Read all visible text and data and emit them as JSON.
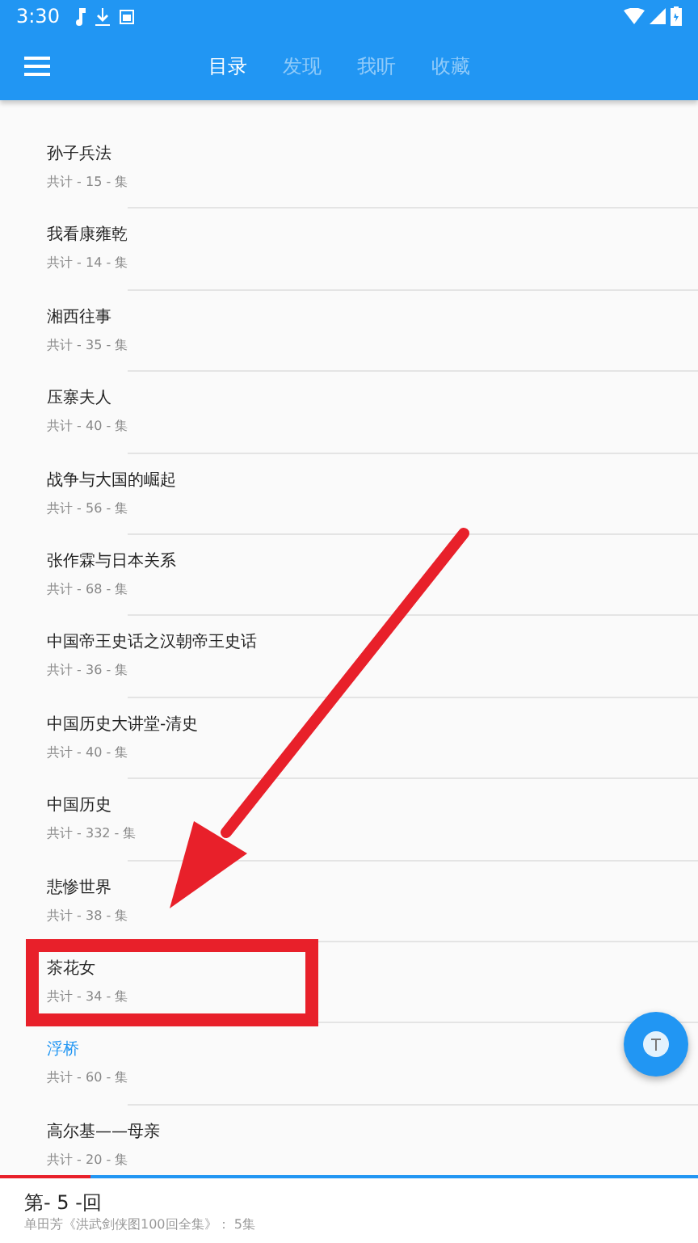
{
  "status_bar": {
    "time": "3:30"
  },
  "toolbar": {
    "tabs": [
      {
        "label": "目录",
        "selected": true
      },
      {
        "label": "发现",
        "selected": false
      },
      {
        "label": "我听",
        "selected": false
      },
      {
        "label": "收藏",
        "selected": false
      }
    ]
  },
  "list": [
    {
      "title": "孙子兵法",
      "count": "共计 - 15 - 集",
      "selected": false
    },
    {
      "title": "我看康雍乾",
      "count": "共计 - 14 - 集",
      "selected": false
    },
    {
      "title": "湘西往事",
      "count": "共计 - 35 - 集",
      "selected": false
    },
    {
      "title": "压寨夫人",
      "count": "共计 - 40 - 集",
      "selected": false
    },
    {
      "title": "战争与大国的崛起",
      "count": "共计 - 56 - 集",
      "selected": false
    },
    {
      "title": "张作霖与日本关系",
      "count": "共计 - 68 - 集",
      "selected": false
    },
    {
      "title": "中国帝王史话之汉朝帝王史话",
      "count": "共计 - 36 - 集",
      "selected": false
    },
    {
      "title": "中国历史大讲堂-清史",
      "count": "共计 - 40 - 集",
      "selected": false
    },
    {
      "title": "中国历史",
      "count": "共计 - 332 - 集",
      "selected": false
    },
    {
      "title": "悲惨世界",
      "count": "共计 - 38 - 集",
      "selected": false
    },
    {
      "title": "茶花女",
      "count": "共计 - 34 - 集",
      "selected": false,
      "highlighted": true
    },
    {
      "title": "浮桥",
      "count": "共计 - 60 - 集",
      "selected": true
    },
    {
      "title": "高尔基——母亲",
      "count": "共计 - 20 - 集",
      "selected": false
    }
  ],
  "player": {
    "level": 0.13,
    "title": "第- 5 -回",
    "subtitle": "单田芳《洪武剑侠图100回全集》： 5集"
  },
  "annotation_arrow": true
}
